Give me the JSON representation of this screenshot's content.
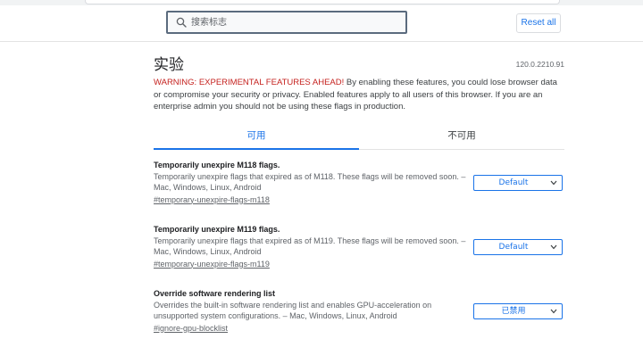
{
  "header": {
    "search_placeholder": "搜索标志",
    "reset_label": "Reset all"
  },
  "main": {
    "title": "实验",
    "version": "120.0.2210.91",
    "warning_heading": "WARNING: EXPERIMENTAL FEATURES AHEAD!",
    "warning_body": " By enabling these features, you could lose browser data or compromise your security or privacy. Enabled features apply to all users of this browser. If you are an enterprise admin you should not be using these flags in production."
  },
  "tabs": [
    {
      "label": "可用",
      "active": true
    },
    {
      "label": "不可用",
      "active": false
    }
  ],
  "experiments": [
    {
      "title": "Temporarily unexpire M118 flags.",
      "description": "Temporarily unexpire flags that expired as of M118. These flags will be removed soon. – Mac, Windows, Linux, Android",
      "link": "#temporary-unexpire-flags-m118",
      "selected": "Default"
    },
    {
      "title": "Temporarily unexpire M119 flags.",
      "description": "Temporarily unexpire flags that expired as of M119. These flags will be removed soon. – Mac, Windows, Linux, Android",
      "link": "#temporary-unexpire-flags-m119",
      "selected": "Default"
    },
    {
      "title": "Override software rendering list",
      "description": "Overrides the built-in software rendering list and enables GPU-acceleration on unsupported system configurations. – Mac, Windows, Linux, Android",
      "link": "#ignore-gpu-blocklist",
      "selected": "已禁用"
    }
  ],
  "colors": {
    "accent": "#1a73e8",
    "warning": "#c5221f",
    "search_border": "#5b6b7e"
  },
  "icons": {
    "search": "search-icon",
    "select_arrow": "chevron-down-icon"
  }
}
